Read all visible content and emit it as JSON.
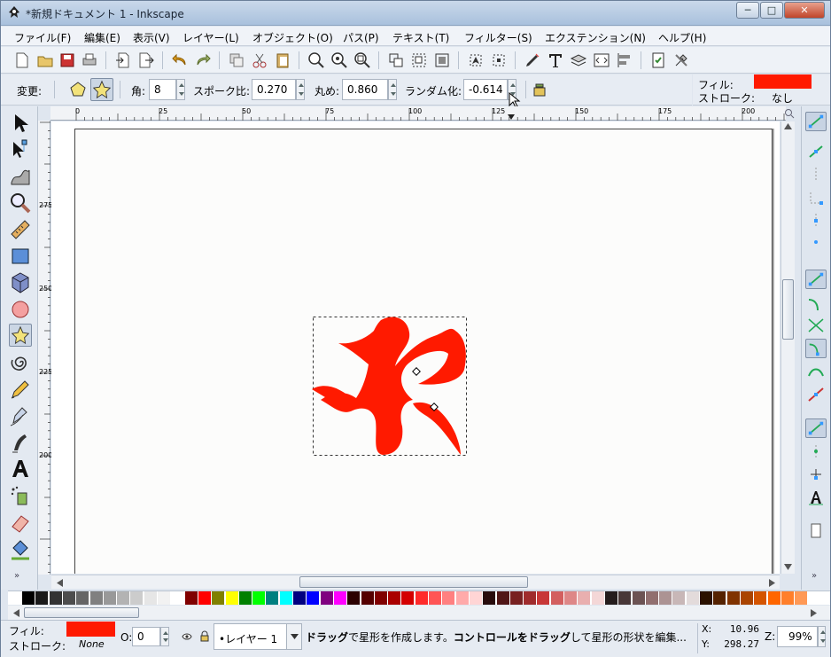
{
  "window": {
    "title": "*新規ドキュメント 1 - Inkscape",
    "buttons": {
      "minimize": "─",
      "maximize": "□",
      "close": "✕"
    }
  },
  "menu": [
    "ファイル(F)",
    "編集(E)",
    "表示(V)",
    "レイヤー(L)",
    "オブジェクト(O)",
    "パス(P)",
    "テキスト(T)",
    "フィルター(S)",
    "エクステンション(N)",
    "ヘルプ(H)"
  ],
  "tool_controls": {
    "change_label": "変更:",
    "corners_label": "角:",
    "corners_value": "8",
    "spoke_label": "スポーク比:",
    "spoke_value": "0.270",
    "rounded_label": "丸め:",
    "rounded_value": "0.860",
    "random_label": "ランダム化:",
    "random_value": "-0.614"
  },
  "style_indicator": {
    "fill_label": "フィル:",
    "stroke_label": "ストローク:",
    "stroke_value": "なし",
    "fill_color": "#ff1a00"
  },
  "ruler": {
    "h_ticks": [
      "0",
      "25",
      "50",
      "75",
      "100",
      "125",
      "150",
      "175",
      "200"
    ],
    "v_ticks": [
      "275",
      "250",
      "225",
      "200"
    ]
  },
  "status": {
    "fill_label": "フィル:",
    "stroke_label": "ストローク:",
    "stroke_value": "None",
    "opacity_label": "O:",
    "opacity_value": "0",
    "layer_value": "•レイヤー 1",
    "message_part1": "ドラッグ",
    "message_part2": "で星形を作成します。",
    "message_part3": "コントロールをドラッグ",
    "message_part4": "して星形の形状を編集...",
    "x_label": "X:",
    "x_value": "10.96",
    "y_label": "Y:",
    "y_value": "298.27",
    "zoom_label": "Z:",
    "zoom_value": "99%"
  },
  "palette_colors": [
    "#000000",
    "#1a1a1a",
    "#333333",
    "#4d4d4d",
    "#666666",
    "#808080",
    "#999999",
    "#b3b3b3",
    "#cccccc",
    "#e6e6e6",
    "#f2f2f2",
    "#ffffff",
    "#800000",
    "#ff0000",
    "#808000",
    "#ffff00",
    "#008000",
    "#00ff00",
    "#008080",
    "#00ffff",
    "#000080",
    "#0000ff",
    "#800080",
    "#ff00ff",
    "#2b0000",
    "#550000",
    "#800000",
    "#aa0000",
    "#d40000",
    "#ff2a2a",
    "#ff5555",
    "#ff8080",
    "#ffaaaa",
    "#ffd5d5",
    "#280b0b",
    "#501616",
    "#782121",
    "#a02c2c",
    "#c83737",
    "#d35f5f",
    "#de8787",
    "#e9afaf",
    "#f4d7d7",
    "#241c1c",
    "#483737",
    "#6c5353",
    "#916f6f",
    "#ac9393",
    "#c8b7b7",
    "#e3dbdb",
    "#2b1100",
    "#552200",
    "#803300",
    "#aa4400",
    "#d45500",
    "#ff6600",
    "#ff7f2a",
    "#ff9955"
  ],
  "icons": {
    "app": "inkscape-icon",
    "fill_color": "#ff1a00"
  }
}
